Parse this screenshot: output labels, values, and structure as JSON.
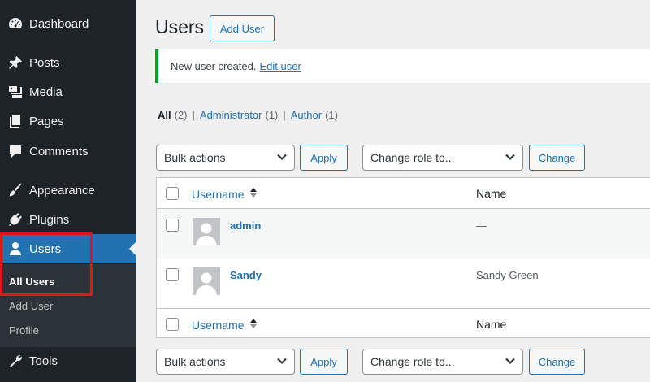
{
  "sidebar": {
    "items": [
      {
        "label": "Dashboard",
        "icon": "dashboard-icon"
      },
      {
        "label": "Posts",
        "icon": "pin-icon"
      },
      {
        "label": "Media",
        "icon": "media-icon"
      },
      {
        "label": "Pages",
        "icon": "pages-icon"
      },
      {
        "label": "Comments",
        "icon": "comments-icon"
      },
      {
        "label": "Appearance",
        "icon": "paintbrush-icon"
      },
      {
        "label": "Plugins",
        "icon": "plugins-icon"
      },
      {
        "label": "Users",
        "icon": "users-icon"
      },
      {
        "label": "Tools",
        "icon": "tools-icon"
      }
    ],
    "submenu": [
      "All Users",
      "Add User",
      "Profile"
    ]
  },
  "header": {
    "title": "Users",
    "add_button": "Add User"
  },
  "notice": {
    "text": "New user created.",
    "link": "Edit user"
  },
  "filters": {
    "all_label": "All",
    "all_count": "(2)",
    "admin_label": "Administrator",
    "admin_count": "(1)",
    "author_label": "Author",
    "author_count": "(1)",
    "separator": "|"
  },
  "toolbar": {
    "bulk_actions": "Bulk actions",
    "apply": "Apply",
    "change_role": "Change role to...",
    "change": "Change"
  },
  "table": {
    "columns": {
      "username": "Username",
      "name": "Name"
    },
    "rows": [
      {
        "username": "admin",
        "name": "—"
      },
      {
        "username": "Sandy",
        "name": "Sandy Green"
      }
    ]
  },
  "colors": {
    "sidebar_bg": "#1d2327",
    "accent": "#2271b1",
    "notice_border": "#00a32a",
    "highlight": "#e2131d"
  }
}
